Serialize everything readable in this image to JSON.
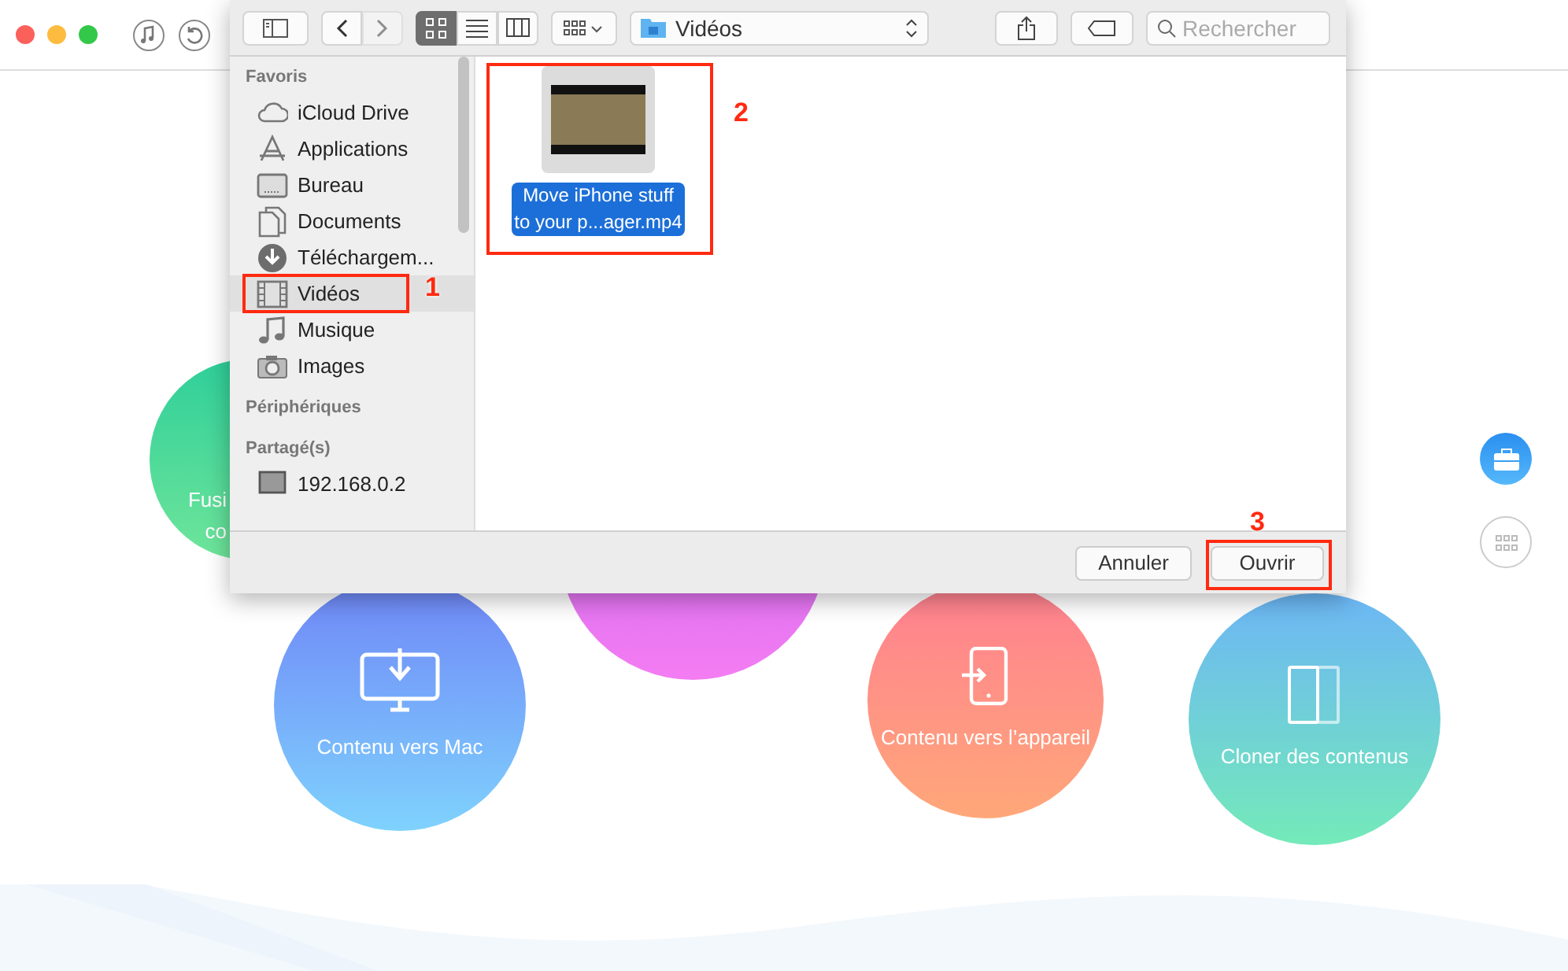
{
  "circles": [
    {
      "kind": "merge",
      "label_lines": [
        "Fusi",
        "co"
      ]
    },
    {
      "kind": "pink"
    },
    {
      "kind": "mac",
      "label_lines": [
        "Contenu vers Mac"
      ]
    },
    {
      "kind": "device",
      "label_lines": [
        "Contenu vers l’appareil"
      ]
    },
    {
      "kind": "clone",
      "label_lines": [
        "Cloner des contenus"
      ]
    }
  ],
  "side_buttons": [
    {
      "kind": "toolbox",
      "selected": true
    },
    {
      "kind": "grid",
      "selected": false
    }
  ],
  "dialog": {
    "nav": [
      {
        "kind": "back",
        "disabled": false
      },
      {
        "kind": "forward",
        "disabled": true
      }
    ],
    "view_modes": [
      {
        "kind": "icons",
        "selected": true
      },
      {
        "kind": "list",
        "selected": false
      },
      {
        "kind": "columns",
        "selected": false
      }
    ],
    "location": "Vidéos",
    "search": {
      "placeholder": "Rechercher"
    },
    "sidebar": [
      {
        "heading": "Favoris",
        "items": [
          {
            "kind": "cloud",
            "label": "iCloud Drive",
            "selected": false
          },
          {
            "kind": "apps",
            "label": "Applications",
            "selected": false
          },
          {
            "kind": "desktop",
            "label": "Bureau",
            "selected": false
          },
          {
            "kind": "document",
            "label": "Documents",
            "selected": false
          },
          {
            "kind": "download",
            "label": "Téléchargem...",
            "selected": false
          },
          {
            "kind": "film",
            "label": "Vidéos",
            "selected": true
          },
          {
            "kind": "music",
            "label": "Musique",
            "selected": false
          },
          {
            "kind": "camera",
            "label": "Images",
            "selected": false
          }
        ]
      },
      {
        "heading": "Périphériques"
      },
      {
        "heading": "Partagé(s)",
        "items": [
          {
            "kind": "computer",
            "label": "192.168.0.2",
            "selected": false
          }
        ]
      }
    ],
    "files": [
      {
        "name_lines": [
          "Move iPhone stuff",
          "to your p...ager.mp4"
        ],
        "selected": true
      }
    ],
    "buttons": [
      {
        "label": "Annuler",
        "kind": "cancel"
      },
      {
        "label": "Ouvrir",
        "kind": "default"
      }
    ]
  },
  "annotations": [
    {
      "label": "1"
    },
    {
      "label": "2"
    },
    {
      "label": "3"
    }
  ]
}
